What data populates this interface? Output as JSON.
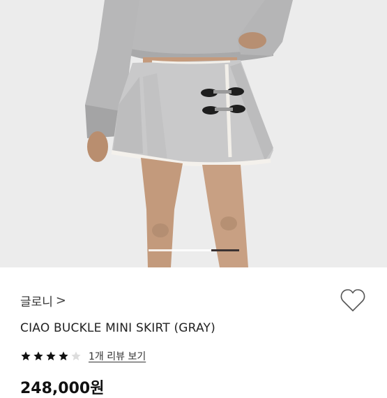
{
  "product": {
    "image_alt": "gray pleated buckle mini skirt worn with gray sweatshirt",
    "carousel": {
      "total": 3,
      "active": 3
    },
    "brand": "글로니",
    "brand_chevron": ">",
    "wishlist_icon": "heart-outline-icon",
    "name": "CIAO BUCKLE MINI SKIRT (GRAY)",
    "rating": {
      "stars_filled": 4,
      "stars_total": 5,
      "star_icon": "star-icon",
      "star_color": "#111111"
    },
    "review_link": "1개 리뷰 보기",
    "price": "248,000원"
  }
}
